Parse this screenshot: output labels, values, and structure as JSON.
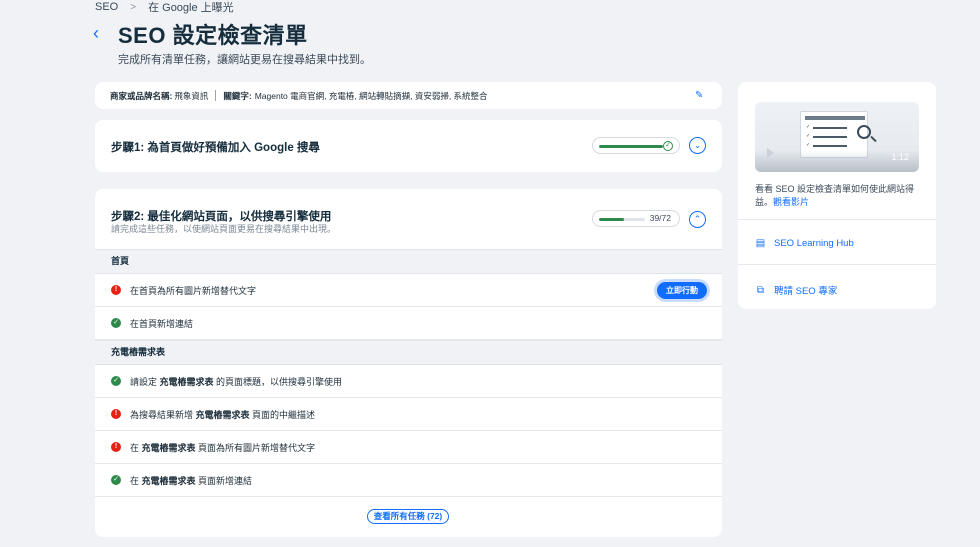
{
  "breadcrumb": {
    "items": [
      "SEO",
      "在 Google 上曝光"
    ]
  },
  "header": {
    "title": "SEO 設定檢查清單",
    "subtitle": "完成所有清單任務，讓網站更易在搜尋結果中找到。"
  },
  "keywords_bar": {
    "brand_label": "商家或品牌名稱:",
    "brand_value": "飛象資訊",
    "keywords_label": "關鍵字:",
    "keywords_value": "Magento 電商官網, 充電樁, 網站轉貼摘擷, 資安弱掃, 系統整合"
  },
  "step1": {
    "title": "步驟1: 為首頁做好預備加入 Google 搜尋",
    "progress_fraction": 1.0
  },
  "step2": {
    "title": "步驟2: 最佳化網站頁面，以供搜尋引擎使用",
    "description": "請完成這些任務，以使網站頁面更易在搜尋結果中出現。",
    "progress_count": "39/72",
    "progress_fraction": 0.54,
    "sections": [
      {
        "header": "首頁",
        "tasks": [
          {
            "status": "error",
            "pre": "在首頁為所有圖片新增替代文字",
            "bold": "",
            "post": "",
            "action": "立即行動"
          },
          {
            "status": "done",
            "pre": "在首頁新增連結",
            "bold": "",
            "post": ""
          }
        ]
      },
      {
        "header": "充電樁需求表",
        "tasks": [
          {
            "status": "done",
            "pre": "請設定 ",
            "bold": "充電樁需求表",
            "post": " 的頁面標題，以供搜尋引擎使用"
          },
          {
            "status": "error",
            "pre": "為搜尋結果新增 ",
            "bold": "充電樁需求表",
            "post": " 頁面的中繼描述"
          },
          {
            "status": "error",
            "pre": "在 ",
            "bold": "充電樁需求表",
            "post": " 頁面為所有圖片新增替代文字"
          },
          {
            "status": "done",
            "pre": "在 ",
            "bold": "充電樁需求表",
            "post": " 頁面新增連結"
          }
        ]
      }
    ],
    "view_all_label": "查看所有任務 (72)"
  },
  "sidebar": {
    "video_duration": "1:12",
    "video_text": "看看 SEO 設定檢查清單如何使此網站得益。",
    "video_link": "觀看影片",
    "links": [
      {
        "label": "SEO Learning Hub",
        "icon": "book-icon"
      },
      {
        "label": "聘請 SEO 專家",
        "icon": "expert-icon"
      }
    ]
  },
  "colors": {
    "accent": "#116dff",
    "success": "#2e8a4a",
    "error": "#e62214",
    "background": "#f0f2f5"
  }
}
